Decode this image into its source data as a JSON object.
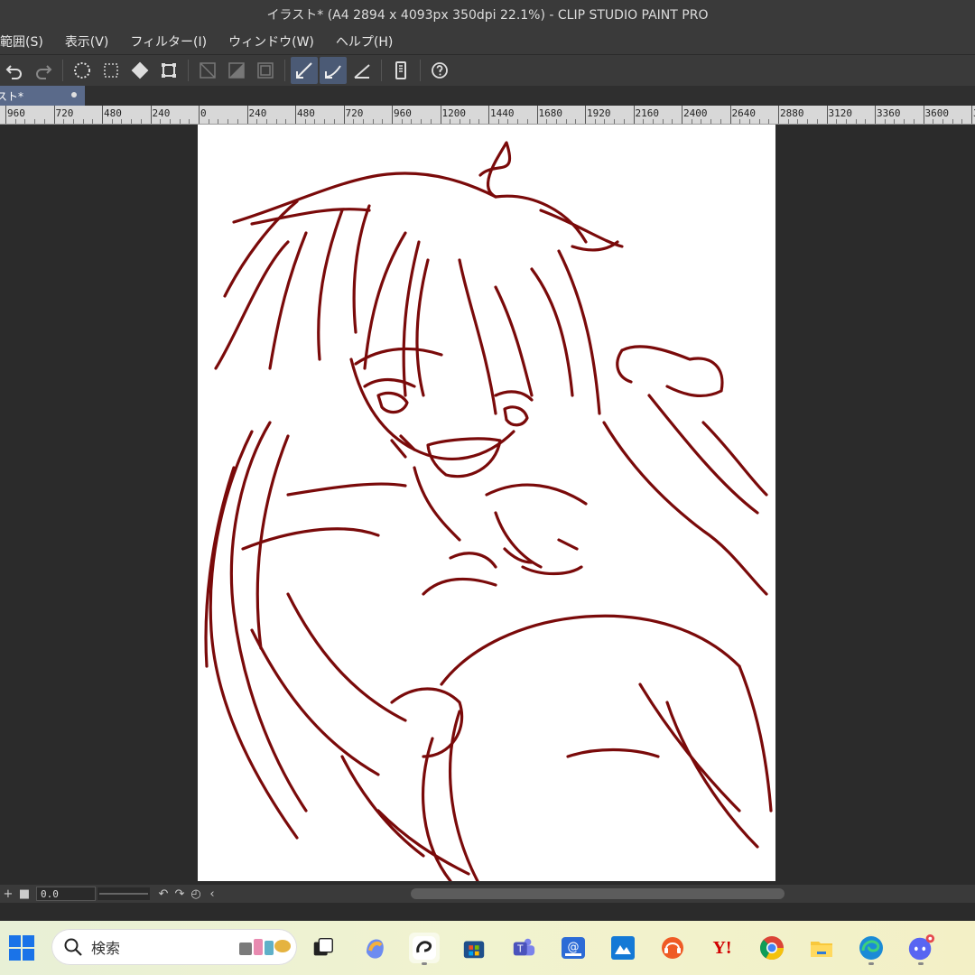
{
  "window": {
    "title": "イラスト* (A4 2894 x 4093px 350dpi 22.1%)  - CLIP STUDIO PAINT PRO"
  },
  "menu": {
    "items": [
      "範囲(S)",
      "表示(V)",
      "フィルター(I)",
      "ウィンドウ(W)",
      "ヘルプ(H)"
    ]
  },
  "toolbar": {
    "icons": [
      "undo-icon",
      "redo-icon",
      "selection-icon",
      "deselect-icon",
      "fill-icon",
      "transform-icon",
      "ruler-hide-icon",
      "layer-fill-icon",
      "frame-icon",
      "snap-ruler-icon",
      "snap-special-ruler-icon",
      "snap-grid-icon",
      "smartphone-icon",
      "help-icon"
    ]
  },
  "tab": {
    "label": "スト*"
  },
  "ruler": {
    "labels": [
      "960",
      "720",
      "480",
      "240",
      "0",
      "240",
      "480",
      "720",
      "960",
      "1200",
      "1440",
      "1680",
      "1920",
      "2160",
      "2400",
      "2640",
      "2880",
      "3120",
      "3360",
      "3600",
      "3"
    ]
  },
  "status": {
    "zoom_value": "0.0"
  },
  "taskbar": {
    "search_placeholder": "検索",
    "yahoo_label": "Y!"
  },
  "colors": {
    "stroke": "#7a0a0a",
    "accent": "#4b5a75"
  }
}
